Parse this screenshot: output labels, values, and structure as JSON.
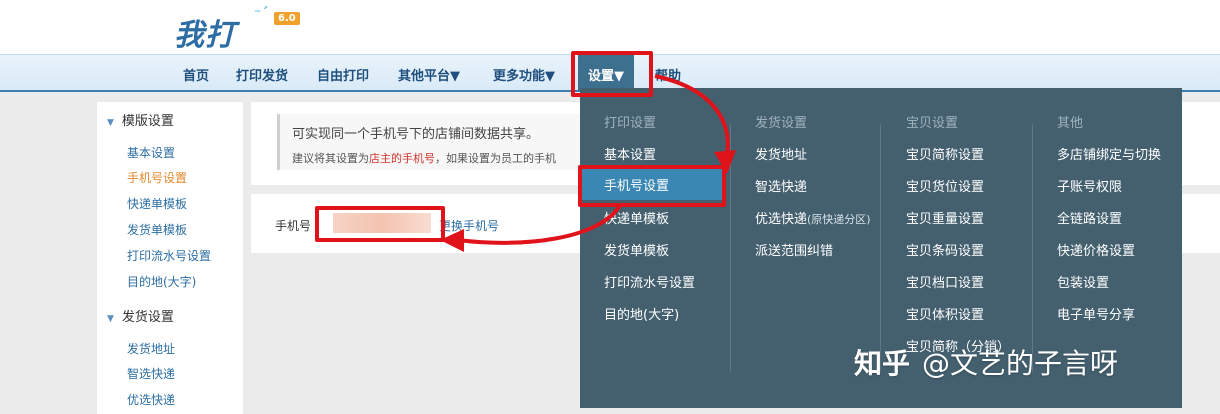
{
  "brand": {
    "logo_text": "我打",
    "version": "6.0"
  },
  "nav": {
    "items": [
      "首页",
      "打印发货",
      "自由打印",
      "其他平台▼",
      "更多功能▼",
      "设置▼",
      "帮助"
    ],
    "active": "设置▼"
  },
  "sidebar": {
    "groups": [
      {
        "title": "模版设置",
        "links": [
          "基本设置",
          "手机号设置",
          "快递单模板",
          "发货单模板",
          "打印流水号设置",
          "目的地(大字)"
        ]
      },
      {
        "title": "发货设置",
        "links": [
          "发货地址",
          "智选快递",
          "优选快递"
        ]
      }
    ],
    "current_link": "手机号设置"
  },
  "notice": {
    "main": "可实现同一个手机号下的店铺间数据共享。",
    "sub_prefix": "建议将其设置为",
    "sub_highlight": "店主的手机号",
    "sub_suffix": "，如果设置为员工的手机"
  },
  "phone": {
    "label": "手机号",
    "value": "",
    "change_link": "更换手机号"
  },
  "dropdown": {
    "columns": [
      {
        "title": "打印设置",
        "items": [
          "基本设置",
          "手机号设置",
          "快递单模板",
          "发货单模板",
          "打印流水号设置",
          "目的地(大字)"
        ]
      },
      {
        "title": "发货设置",
        "items": [
          "发货地址",
          "智选快递",
          "优选快递",
          "派送范围纠错"
        ],
        "item_notes": {
          "优选快递": "(原快递分区)"
        }
      },
      {
        "title": "宝贝设置",
        "items": [
          "宝贝简称设置",
          "宝贝货位设置",
          "宝贝重量设置",
          "宝贝条码设置",
          "宝贝档口设置",
          "宝贝体积设置",
          "宝贝简称（分销）"
        ]
      },
      {
        "title": "其他",
        "items": [
          "多店铺绑定与切换",
          "子账号权限",
          "全链路设置",
          "快递价格设置",
          "包装设置",
          "电子单号分享"
        ]
      }
    ],
    "selected": "手机号设置"
  },
  "watermark": {
    "zhihu": "知乎",
    "author": "@文艺的子言呀"
  },
  "colors": {
    "nav_text": "#1f4f7d",
    "nav_active_bg": "#3d6f8e",
    "dropdown_bg": "#44606f",
    "menu_selected_bg": "#3a87b4",
    "link": "#2c6ea3",
    "current_link": "#e08a2c",
    "highlight_red": "#e0121a",
    "badge": "#f0a02c"
  }
}
